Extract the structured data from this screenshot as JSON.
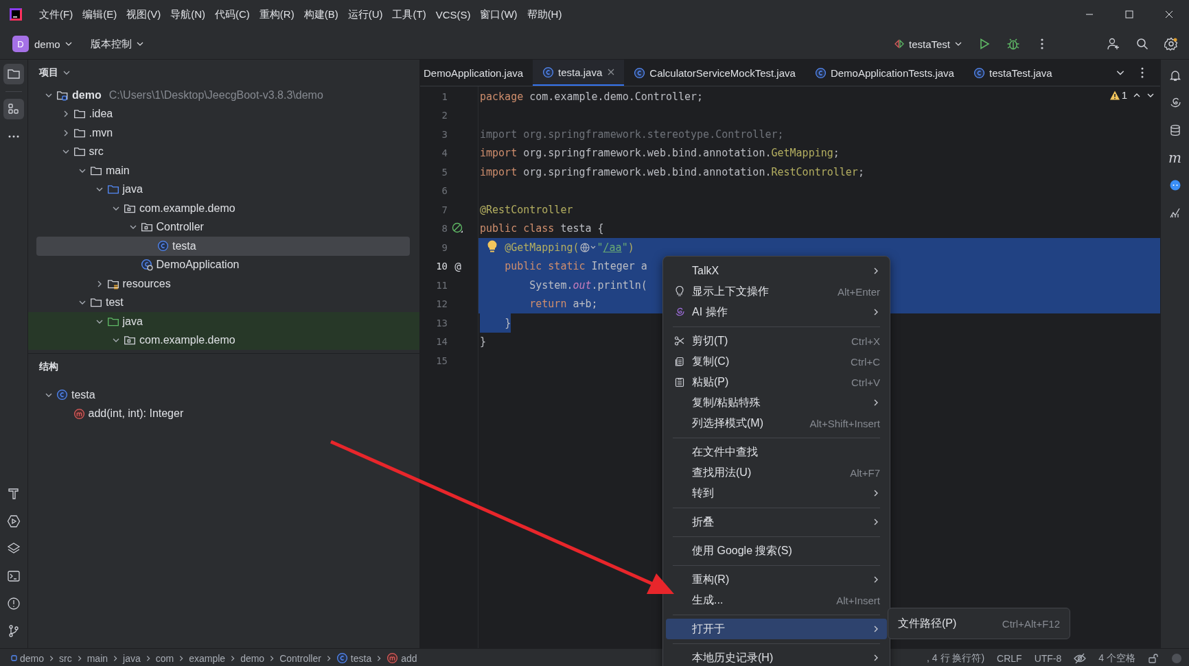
{
  "title_bar": {
    "menus": [
      "文件(F)",
      "编辑(E)",
      "视图(V)",
      "导航(N)",
      "代码(C)",
      "重构(R)",
      "构建(B)",
      "运行(U)",
      "工具(T)",
      "VCS(S)",
      "窗口(W)",
      "帮助(H)"
    ]
  },
  "toolbar": {
    "project_badge": "D",
    "project": "demo",
    "vcs": "版本控制",
    "run_config": "testaTest"
  },
  "project_panel": {
    "title": "项目",
    "tree": [
      {
        "label": "demo",
        "path": "C:\\Users\\1\\Desktop\\JeecgBoot-v3.8.3\\demo",
        "kind": "module",
        "expanded": true,
        "selected": false,
        "highlighted": false,
        "children": [
          {
            "label": ".idea",
            "kind": "folder",
            "expanded": false,
            "selected": false,
            "highlighted": false
          },
          {
            "label": ".mvn",
            "kind": "folder",
            "expanded": false,
            "selected": false,
            "highlighted": false
          },
          {
            "label": "src",
            "kind": "folder",
            "expanded": true,
            "selected": false,
            "highlighted": false,
            "children": [
              {
                "label": "main",
                "kind": "folder",
                "expanded": true,
                "selected": false,
                "highlighted": false,
                "children": [
                  {
                    "label": "java",
                    "kind": "source-folder",
                    "expanded": true,
                    "selected": false,
                    "highlighted": false,
                    "children": [
                      {
                        "label": "com.example.demo",
                        "kind": "package",
                        "expanded": true,
                        "selected": false,
                        "highlighted": false,
                        "children": [
                          {
                            "label": "Controller",
                            "kind": "package",
                            "expanded": true,
                            "selected": false,
                            "highlighted": false,
                            "children": [
                              {
                                "label": "testa",
                                "kind": "class",
                                "selected": true,
                                "highlighted": false
                              }
                            ]
                          },
                          {
                            "label": "DemoApplication",
                            "kind": "app-class",
                            "selected": false,
                            "highlighted": false
                          }
                        ]
                      }
                    ]
                  },
                  {
                    "label": "resources",
                    "kind": "resources-folder",
                    "expanded": false,
                    "selected": false,
                    "highlighted": false
                  }
                ]
              },
              {
                "label": "test",
                "kind": "folder",
                "expanded": true,
                "selected": false,
                "highlighted": false,
                "children": [
                  {
                    "label": "java",
                    "kind": "test-folder",
                    "expanded": true,
                    "selected": false,
                    "highlighted": true,
                    "children": [
                      {
                        "label": "com.example.demo",
                        "kind": "package",
                        "expanded": true,
                        "selected": false,
                        "highlighted": true
                      }
                    ]
                  }
                ]
              }
            ]
          }
        ]
      }
    ]
  },
  "structure_panel": {
    "title": "结构",
    "tree": [
      {
        "label": "testa",
        "kind": "class",
        "expanded": true,
        "selected": false,
        "highlighted": false,
        "children": [
          {
            "label": "add(int, int): Integer",
            "kind": "method",
            "selected": false,
            "highlighted": false
          }
        ]
      }
    ]
  },
  "editor": {
    "tabs": [
      {
        "label": "DemoApplication.java",
        "selected": false,
        "kind": "plain"
      },
      {
        "label": "testa.java",
        "selected": true,
        "kind": "class"
      },
      {
        "label": "CalculatorServiceMockTest.java",
        "selected": false,
        "kind": "class"
      },
      {
        "label": "DemoApplicationTests.java",
        "selected": false,
        "kind": "class"
      },
      {
        "label": "testaTest.java",
        "selected": false,
        "kind": "class"
      }
    ],
    "inspection_count": "1",
    "lines": [
      {
        "number": "1",
        "current": false,
        "selected": false,
        "kind": "code",
        "tokens": [
          {
            "kind": "keyword",
            "text": "package"
          },
          {
            "kind": "plain",
            "text": " com.example.demo.Controller;"
          }
        ]
      },
      {
        "number": "2",
        "current": false,
        "selected": false,
        "kind": "code"
      },
      {
        "number": "3",
        "current": false,
        "selected": false,
        "kind": "code",
        "tokens": [
          {
            "kind": "unused",
            "text": "import org.springframework.stereotype.Controller;"
          }
        ]
      },
      {
        "number": "4",
        "current": false,
        "selected": false,
        "kind": "code",
        "tokens": [
          {
            "kind": "keyword",
            "text": "import"
          },
          {
            "kind": "plain",
            "text": " org.springframework.web.bind.annotation."
          },
          {
            "kind": "annotation",
            "text": "GetMapping"
          },
          {
            "kind": "plain",
            "text": ";"
          }
        ]
      },
      {
        "number": "5",
        "current": false,
        "selected": false,
        "kind": "code",
        "tokens": [
          {
            "kind": "keyword",
            "text": "import"
          },
          {
            "kind": "plain",
            "text": " org.springframework.web.bind.annotation."
          },
          {
            "kind": "annotation",
            "text": "RestController"
          },
          {
            "kind": "plain",
            "text": ";"
          }
        ]
      },
      {
        "number": "6",
        "current": false,
        "selected": false,
        "kind": "code"
      },
      {
        "number": "7",
        "current": false,
        "selected": false,
        "kind": "code",
        "tokens": [
          {
            "kind": "annotation",
            "text": "@RestController"
          }
        ]
      },
      {
        "number": "8",
        "current": false,
        "selected": false,
        "kind": "run",
        "tokens": [
          {
            "kind": "keyword",
            "text": "public class"
          },
          {
            "kind": "plain",
            "text": " testa {"
          }
        ]
      },
      {
        "number": "9",
        "current": false,
        "selected": true,
        "kind": "bulb",
        "tokens": [
          {
            "kind": "annotation",
            "text": "    @GetMapping("
          },
          {
            "kind": "inlay"
          },
          {
            "kind": "string",
            "text": "\""
          },
          {
            "kind": "link",
            "text": "/aa"
          },
          {
            "kind": "string",
            "text": "\""
          },
          {
            "kind": "annotation",
            "text": ")"
          }
        ]
      },
      {
        "number": "10",
        "current": true,
        "selected": true,
        "kind": "code",
        "marker": "@",
        "tokens": [
          {
            "kind": "keyword",
            "text": "    public static"
          },
          {
            "kind": "plain",
            "text": " Integer a"
          }
        ]
      },
      {
        "number": "11",
        "current": false,
        "selected": true,
        "kind": "code",
        "tokens": [
          {
            "kind": "plain",
            "text": "        System."
          },
          {
            "kind": "field",
            "text": "out"
          },
          {
            "kind": "plain",
            "text": ".println("
          }
        ]
      },
      {
        "number": "12",
        "current": false,
        "selected": true,
        "kind": "code",
        "tokens": [
          {
            "kind": "keyword",
            "text": "        return"
          },
          {
            "kind": "plain",
            "text": " a+b;"
          }
        ]
      },
      {
        "number": "13",
        "current": false,
        "selected": true,
        "kind": "code",
        "tokens": [
          {
            "kind": "plain",
            "text": "    }"
          }
        ]
      },
      {
        "number": "14",
        "current": false,
        "selected": false,
        "kind": "code",
        "tokens": [
          {
            "kind": "plain",
            "text": "}"
          }
        ]
      },
      {
        "number": "15",
        "current": false,
        "selected": false,
        "kind": "code"
      }
    ]
  },
  "right_strip": {
    "maven_label": "m"
  },
  "context_menu": {
    "items": [
      {
        "kind": "item",
        "label": "TalkX",
        "submenu": true,
        "selected": false
      },
      {
        "kind": "bulb",
        "label": "显示上下文操作",
        "shortcut": "Alt+Enter",
        "submenu": false,
        "selected": false
      },
      {
        "kind": "ai",
        "label": "AI 操作",
        "submenu": true,
        "selected": false
      },
      {
        "kind": "separator"
      },
      {
        "kind": "cut",
        "label": "剪切(T)",
        "shortcut": "Ctrl+X",
        "submenu": false,
        "selected": false
      },
      {
        "kind": "copy",
        "label": "复制(C)",
        "shortcut": "Ctrl+C",
        "submenu": false,
        "selected": false
      },
      {
        "kind": "paste",
        "label": "粘贴(P)",
        "shortcut": "Ctrl+V",
        "submenu": false,
        "selected": false
      },
      {
        "kind": "item",
        "label": "复制/粘贴特殊",
        "submenu": true,
        "selected": false
      },
      {
        "kind": "item",
        "label": "列选择模式(M)",
        "shortcut": "Alt+Shift+Insert",
        "submenu": false,
        "selected": false
      },
      {
        "kind": "separator"
      },
      {
        "kind": "item",
        "label": "在文件中查找",
        "submenu": false,
        "selected": false
      },
      {
        "kind": "item",
        "label": "查找用法(U)",
        "shortcut": "Alt+F7",
        "submenu": false,
        "selected": false
      },
      {
        "kind": "item",
        "label": "转到",
        "submenu": true,
        "selected": false
      },
      {
        "kind": "separator"
      },
      {
        "kind": "item",
        "label": "折叠",
        "submenu": true,
        "selected": false
      },
      {
        "kind": "separator"
      },
      {
        "kind": "item",
        "label": "使用 Google 搜索(S)",
        "submenu": false,
        "selected": false
      },
      {
        "kind": "separator"
      },
      {
        "kind": "item",
        "label": "重构(R)",
        "submenu": true,
        "selected": false
      },
      {
        "kind": "item",
        "label": "生成...",
        "shortcut": "Alt+Insert",
        "submenu": false,
        "selected": false
      },
      {
        "kind": "separator"
      },
      {
        "kind": "item",
        "label": "打开于",
        "submenu": true,
        "selected": true
      },
      {
        "kind": "separator"
      },
      {
        "kind": "item",
        "label": "本地历史记录(H)",
        "submenu": true,
        "selected": false
      }
    ]
  },
  "submenu": {
    "items": [
      {
        "label": "文件路径(P)",
        "shortcut": "Ctrl+Alt+F12"
      }
    ]
  },
  "status_bar": {
    "breadcrumbs": [
      {
        "label": "demo",
        "kind": "module"
      },
      {
        "label": "src",
        "kind": "plain"
      },
      {
        "label": "main",
        "kind": "plain"
      },
      {
        "label": "java",
        "kind": "plain"
      },
      {
        "label": "com",
        "kind": "plain"
      },
      {
        "label": "example",
        "kind": "plain"
      },
      {
        "label": "demo",
        "kind": "plain"
      },
      {
        "label": "Controller",
        "kind": "plain"
      },
      {
        "label": "testa",
        "kind": "class"
      },
      {
        "label": "add",
        "kind": "method"
      }
    ],
    "line_info": ", 4 行 换行符)",
    "line_separator": "CRLF",
    "encoding": "UTF-8",
    "indent": "4 个空格"
  }
}
